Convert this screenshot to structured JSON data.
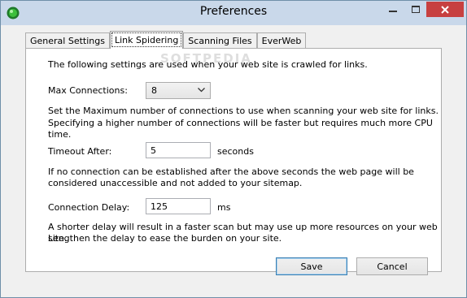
{
  "window": {
    "title": "Preferences"
  },
  "tabs": [
    {
      "label": "General Settings"
    },
    {
      "label": "Link Spidering"
    },
    {
      "label": "Scanning Files"
    },
    {
      "label": "EverWeb"
    }
  ],
  "active_tab": "Link Spidering",
  "watermark": "SOFTPEDIA",
  "panel": {
    "intro": "The following settings are used when your web site is crawled for links.",
    "max_connections": {
      "label": "Max Connections:",
      "value": "8",
      "help_line1": "Set the Maximum number of connections to use when scanning your web site for links.",
      "help_line2": "Specifying a higher number of connections will be faster but requires much more CPU time."
    },
    "timeout": {
      "label": "Timeout After:",
      "value": "5",
      "unit": "seconds",
      "help_line1": "If no connection can be established after the above seconds the web page will be",
      "help_line2": "considered unaccessible and not added to your sitemap."
    },
    "delay": {
      "label": "Connection Delay:",
      "value": "125",
      "unit": "ms",
      "help_line1": "A shorter delay will result in a faster scan but may use up more resources on your web site.",
      "help_line2": "Lengthen the delay to ease the burden on your site."
    }
  },
  "buttons": {
    "save": "Save",
    "cancel": "Cancel"
  },
  "colors": {
    "titlebar": "#c9d8ea",
    "close": "#c74040",
    "panel": "#ffffff",
    "window": "#f0f0f0"
  }
}
